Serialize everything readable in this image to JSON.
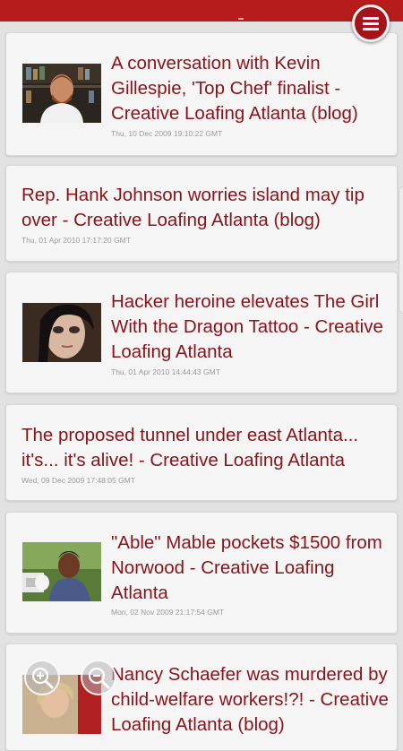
{
  "articles": [
    {
      "title": "A conversation with Kevin Gillespie, 'Top Chef' finalist - Creative Loafing Atlanta (blog)",
      "date": "Thu, 10 Dec 2009 19:10:22 GMT",
      "has_image": true
    },
    {
      "title": "Rep. Hank Johnson worries island may tip over - Creative Loafing Atlanta (blog)",
      "date": "Thu, 01 Apr 2010 17:17:20 GMT",
      "has_image": false
    },
    {
      "title": "Hacker heroine elevates The Girl With the Dragon Tattoo - Creative Loafing Atlanta",
      "date": "Thu, 01 Apr 2010 14:44:43 GMT",
      "has_image": true
    },
    {
      "title": "The proposed tunnel under east Atlanta... it's... it's alive! - Creative Loafing Atlanta",
      "date": "Wed, 09 Dec 2009 17:48:05 GMT",
      "has_image": false
    },
    {
      "title": "\"Able\" Mable pockets $1500 from Norwood - Creative Loafing Atlanta",
      "date": "Mon, 02 Nov 2009 21:17:54 GMT",
      "has_image": true
    },
    {
      "title": "Nancy Schaefer was murdered by child-welfare workers!?! - Creative Loafing Atlanta (blog)",
      "date": "",
      "has_image": true
    }
  ],
  "colors": {
    "accent": "#b71c1c",
    "title": "#8b1218"
  },
  "icons": {
    "menu": "hamburger-menu-icon",
    "zoom_in": "zoom-in-icon",
    "zoom_out": "zoom-out-icon"
  }
}
